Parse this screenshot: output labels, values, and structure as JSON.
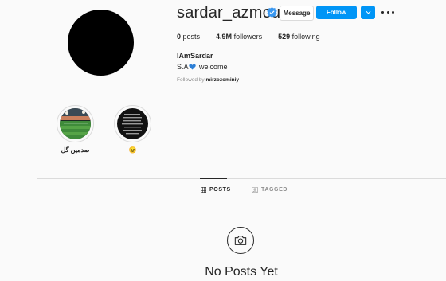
{
  "profile": {
    "username": "sardar_azmoun",
    "full_name": "IAmSardar",
    "bio_prefix": "S.A",
    "bio_suffix": "welcome",
    "followed_by_prefix": "Followed by",
    "followed_by_user": "mirzozominiy"
  },
  "actions": {
    "message_label": "Message",
    "follow_label": "Follow"
  },
  "stats": [
    {
      "count": "0",
      "label": "posts"
    },
    {
      "count": "4.9M",
      "label": "followers"
    },
    {
      "count": "529",
      "label": "following"
    }
  ],
  "highlights": [
    {
      "label": "صدمین گل"
    },
    {
      "label": "😉"
    }
  ],
  "tabs": [
    {
      "label": "POSTS"
    },
    {
      "label": "TAGGED"
    }
  ],
  "empty_state": {
    "text": "No Posts Yet"
  },
  "colors": {
    "accent": "#0095f6",
    "text": "#262626",
    "muted": "#8e8e8e"
  }
}
